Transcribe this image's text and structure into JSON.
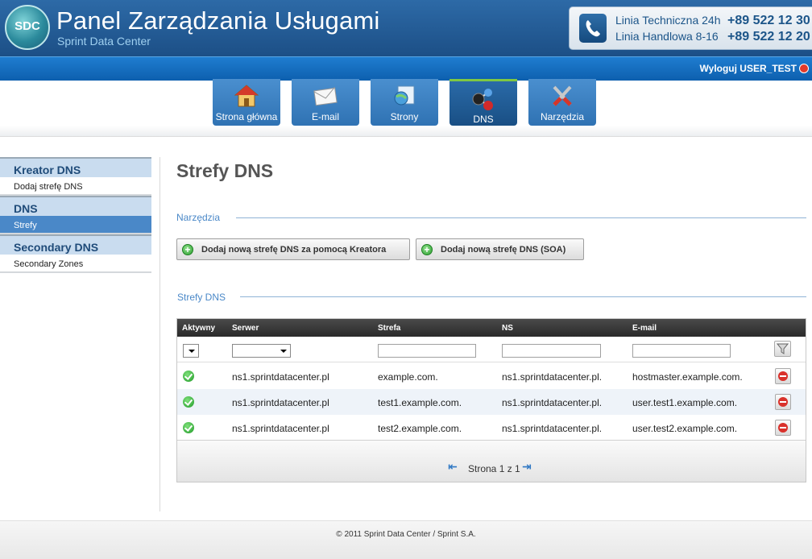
{
  "header": {
    "logo": "SDC",
    "title": "Panel Zarządzania Usługami",
    "subtitle": "Sprint Data Center",
    "support": {
      "tech_label": "Linia Techniczna 24h",
      "tech_phone": "+89 522 12 30",
      "sales_label": "Linia Handlowa 8-16",
      "sales_phone": "+89 522 12 20"
    },
    "logout_label": "Wyloguj USER_TEST"
  },
  "nav": {
    "tabs": [
      {
        "label": "Strona główna",
        "icon": "house-icon"
      },
      {
        "label": "E-mail",
        "icon": "envelope-icon"
      },
      {
        "label": "Strony",
        "icon": "webpage-icon"
      },
      {
        "label": "DNS",
        "icon": "network-nodes-icon",
        "active": true
      },
      {
        "label": "Narzędzia",
        "icon": "tools-icon"
      }
    ]
  },
  "sidebar": {
    "groups": [
      {
        "title": "Kreator DNS",
        "items": [
          {
            "label": "Dodaj strefę DNS"
          }
        ]
      },
      {
        "title": "DNS",
        "items": [
          {
            "label": "Strefy",
            "active": true
          }
        ]
      },
      {
        "title": "Secondary DNS",
        "items": [
          {
            "label": "Secondary Zones"
          }
        ]
      }
    ]
  },
  "main": {
    "title": "Strefy DNS",
    "tools_label": "Narzędzia",
    "buttons": {
      "wizard": "Dodaj nową strefę DNS za pomocą Kreatora",
      "soa": "Dodaj nową strefę DNS (SOA)"
    },
    "zones_label": "Strefy DNS",
    "table": {
      "columns": [
        "Aktywny",
        "Serwer",
        "Strefa",
        "NS",
        "E-mail"
      ],
      "rows": [
        {
          "active": true,
          "server": "ns1.sprintdatacenter.pl",
          "zone": "example.com.",
          "ns": "ns1.sprintdatacenter.pl.",
          "email": "hostmaster.example.com."
        },
        {
          "active": true,
          "server": "ns1.sprintdatacenter.pl",
          "zone": "test1.example.com.",
          "ns": "ns1.sprintdatacenter.pl.",
          "email": "user.test1.example.com."
        },
        {
          "active": true,
          "server": "ns1.sprintdatacenter.pl",
          "zone": "test2.example.com.",
          "ns": "ns1.sprintdatacenter.pl.",
          "email": "user.test2.example.com."
        }
      ],
      "pager": "Strona 1 z 1"
    }
  },
  "footer": "© 2011 Sprint Data Center / Sprint S.A.",
  "colors": {
    "brand_blue": "#1c4f86",
    "accent_blue": "#4a88c8",
    "active_tab_marker": "#7fc843"
  }
}
